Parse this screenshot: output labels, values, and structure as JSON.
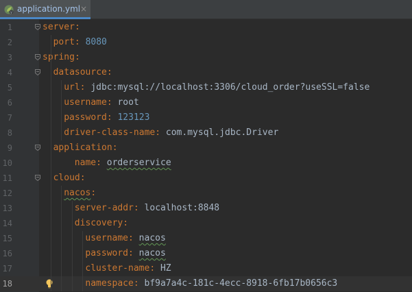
{
  "tab": {
    "filename": "application.yml",
    "close": "×",
    "icon": "spring-leaf-icon"
  },
  "colors": {
    "key": "#cc7832",
    "number": "#6897bb",
    "text": "#a9b7c6",
    "background": "#2b2b2b",
    "gutter": "#313335"
  },
  "lines": [
    {
      "n": "1",
      "indent": 0,
      "key": "server",
      "value": ""
    },
    {
      "n": "2",
      "indent": 2,
      "key": "port",
      "value": "8080"
    },
    {
      "n": "3",
      "indent": 0,
      "key": "spring",
      "value": ""
    },
    {
      "n": "4",
      "indent": 2,
      "key": "datasource",
      "value": ""
    },
    {
      "n": "5",
      "indent": 4,
      "key": "url",
      "value": "jdbc:mysql://localhost:3306/cloud_order?useSSL=false"
    },
    {
      "n": "6",
      "indent": 4,
      "key": "username",
      "value": "root"
    },
    {
      "n": "7",
      "indent": 4,
      "key": "password",
      "value": "123123"
    },
    {
      "n": "8",
      "indent": 4,
      "key": "driver-class-name",
      "value": "com.mysql.jdbc.Driver"
    },
    {
      "n": "9",
      "indent": 2,
      "key": "application",
      "value": ""
    },
    {
      "n": "10",
      "indent": 6,
      "key": "name",
      "value": "orderservice"
    },
    {
      "n": "11",
      "indent": 2,
      "key": "cloud",
      "value": ""
    },
    {
      "n": "12",
      "indent": 4,
      "key": "nacos",
      "value": ""
    },
    {
      "n": "13",
      "indent": 6,
      "key": "server-addr",
      "value": "localhost:8848"
    },
    {
      "n": "14",
      "indent": 6,
      "key": "discovery",
      "value": ""
    },
    {
      "n": "15",
      "indent": 8,
      "key": "username",
      "value": "nacos"
    },
    {
      "n": "16",
      "indent": 8,
      "key": "password",
      "value": "nacos"
    },
    {
      "n": "17",
      "indent": 8,
      "key": "cluster-name",
      "value": "HZ"
    },
    {
      "n": "18",
      "indent": 8,
      "key": "namespace",
      "value": "bf9a7a4c-181c-4ecc-8918-6fb17b0656c3"
    }
  ]
}
